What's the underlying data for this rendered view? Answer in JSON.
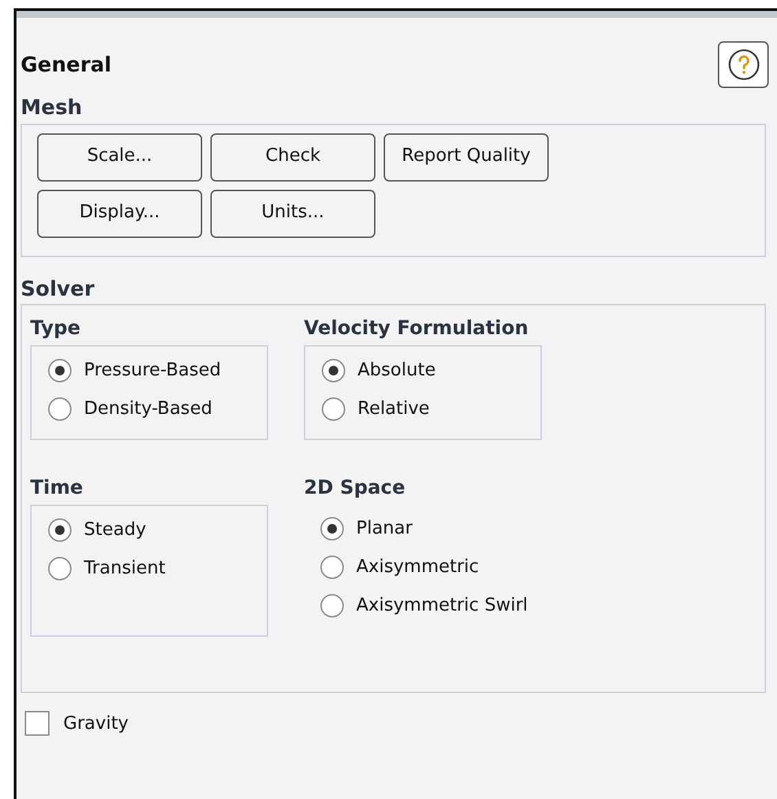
{
  "title": "General",
  "mesh": {
    "label": "Mesh",
    "buttons": [
      [
        "Scale...",
        "Check",
        "Report Quality"
      ],
      [
        "Display...",
        "Units..."
      ]
    ]
  },
  "solver": {
    "label": "Solver",
    "groups": [
      {
        "label": "Type",
        "boxed": true,
        "options": [
          {
            "label": "Pressure-Based",
            "selected": true
          },
          {
            "label": "Density-Based",
            "selected": false
          }
        ]
      },
      {
        "label": "Velocity Formulation",
        "boxed": true,
        "options": [
          {
            "label": "Absolute",
            "selected": true
          },
          {
            "label": "Relative",
            "selected": false
          }
        ]
      },
      {
        "label": "Time",
        "boxed": true,
        "options": [
          {
            "label": "Steady",
            "selected": true
          },
          {
            "label": "Transient",
            "selected": false
          }
        ]
      },
      {
        "label": "2D Space",
        "boxed": false,
        "options": [
          {
            "label": "Planar",
            "selected": true
          },
          {
            "label": "Axisymmetric",
            "selected": false
          },
          {
            "label": "Axisymmetric Swirl",
            "selected": false
          }
        ]
      }
    ]
  },
  "gravity": {
    "label": "Gravity",
    "checked": false
  }
}
